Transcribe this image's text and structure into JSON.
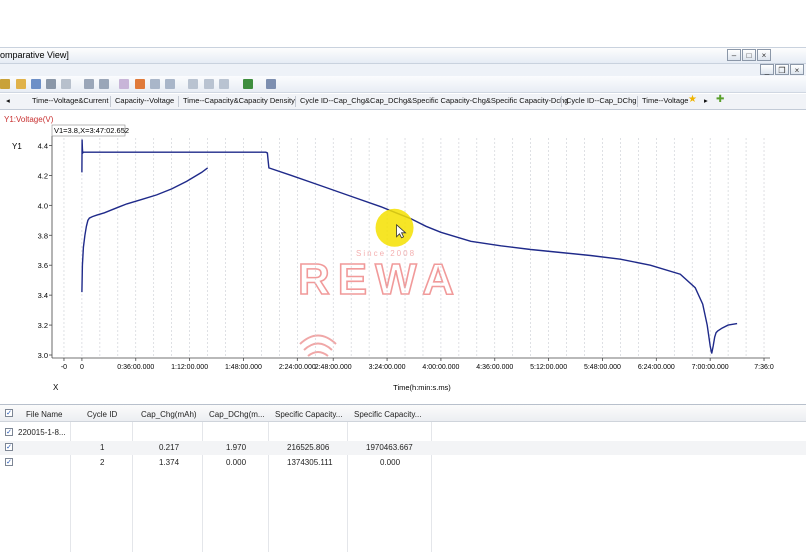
{
  "window": {
    "title": "omparative View]",
    "child_controls": [
      "_",
      "❒",
      "×"
    ],
    "main_controls": [
      "–",
      "□",
      "×"
    ]
  },
  "tabs": [
    "Time--Voltage&Current",
    "Capacity--Voltage",
    "Time--Capacity&Capacity Density",
    "Cycle ID--Cap_Chg&Cap_DChg&Specific Capacity-Chg&Specific Capacity-Dchg",
    "Cycle ID--Cap_DChg",
    "Time--Voltage"
  ],
  "chart": {
    "corner_label": "Y1:Voltage(V)",
    "cursor_readout": "V1=3.8,X=3:47:02.652",
    "y_axis_name": "Y1",
    "x_axis_name": "X",
    "x_title": "Time(h:min:s.ms)"
  },
  "chart_data": {
    "type": "line",
    "ylim": [
      3.0,
      4.4
    ],
    "y_ticks": [
      "3.0",
      "3.2",
      "3.4",
      "3.6",
      "3.8",
      "4.0",
      "4.2",
      "4.4"
    ],
    "y_tick_values": [
      3.0,
      3.2,
      3.4,
      3.6,
      3.8,
      4.0,
      4.2,
      4.4
    ],
    "x_ticks": [
      "-0",
      "0",
      "0:36:00.000",
      "1:12:00.000",
      "1:48:00.000",
      "2:24:00.000",
      "2:48:00.000",
      "3:24:00.000",
      "4:00:00.000",
      "4:36:00.000",
      "5:12:00.000",
      "5:48:00.000",
      "6:24:00.000",
      "7:00:00.000",
      "7:36:0"
    ],
    "x_tick_minutes": [
      -12,
      0,
      36,
      72,
      108,
      144,
      168,
      204,
      240,
      276,
      312,
      348,
      384,
      420,
      456
    ],
    "xlim": [
      -20,
      460
    ],
    "grid": true,
    "series": [
      {
        "x": [
          0,
          0.3,
          1,
          2,
          3,
          4,
          5,
          7,
          10,
          15,
          20,
          25,
          30,
          40,
          50,
          60,
          70,
          80,
          84
        ],
        "y": [
          3.42,
          3.6,
          3.72,
          3.8,
          3.86,
          3.9,
          3.915,
          3.925,
          3.935,
          3.95,
          3.97,
          3.99,
          4.01,
          4.04,
          4.07,
          4.11,
          4.16,
          4.22,
          4.25
        ]
      },
      {
        "x": [
          0,
          0.15,
          0.3,
          0.5,
          1,
          5,
          30,
          60,
          90,
          110,
          123,
          124,
          124.5,
          125,
          140,
          160,
          180,
          200,
          210,
          220,
          230,
          240,
          260,
          280,
          300,
          320,
          340,
          360,
          380,
          400,
          410,
          415,
          418,
          420,
          421,
          422,
          423,
          424,
          425,
          428,
          432,
          438
        ],
        "y": [
          4.22,
          4.44,
          4.38,
          4.35,
          4.355,
          4.355,
          4.355,
          4.355,
          4.355,
          4.355,
          4.355,
          4.35,
          4.3,
          4.25,
          4.2,
          4.13,
          4.06,
          3.99,
          3.95,
          3.91,
          3.86,
          3.82,
          3.76,
          3.73,
          3.705,
          3.685,
          3.665,
          3.64,
          3.6,
          3.54,
          3.45,
          3.34,
          3.2,
          3.06,
          3.01,
          3.06,
          3.12,
          3.15,
          3.16,
          3.18,
          3.2,
          3.21
        ]
      }
    ],
    "cursor": {
      "x": 209,
      "y": 3.85
    }
  },
  "watermark": {
    "text": "REWA",
    "sub": "Since 2008"
  },
  "table": {
    "headers": [
      "File Name",
      "Cycle ID",
      "Cap_Chg(mAh)",
      "Cap_DChg(m...",
      "Specific Capacity...",
      "Specific Capacity..."
    ],
    "group": "220015-1-8...",
    "rows": [
      [
        "",
        "1",
        "0.217",
        "1.970",
        "216525.806",
        "1970463.667"
      ],
      [
        "",
        "2",
        "1.374",
        "0.000",
        "1374305.111",
        "0.000"
      ]
    ]
  },
  "colors": {
    "series": "#1f2a8a",
    "accent": "#e07070",
    "cursor_highlight": "#f5e100"
  }
}
